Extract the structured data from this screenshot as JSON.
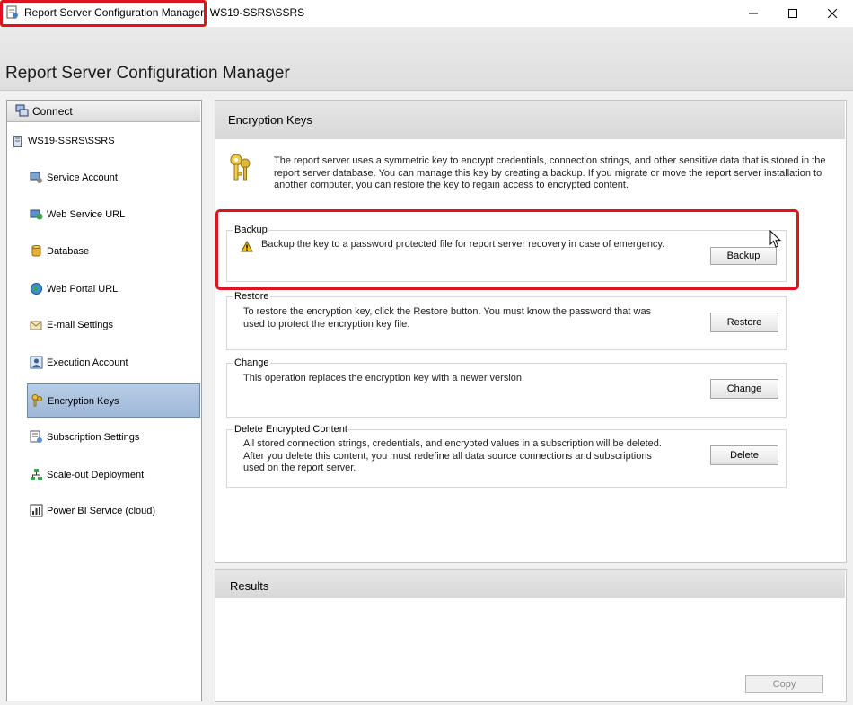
{
  "window": {
    "title_app": "Report Server Configuration Manager",
    "title_sep": ": ",
    "title_server": "WS19-SSRS\\SSRS",
    "minimize_glyph": "—",
    "maximize_glyph": "☐",
    "close_glyph": "✕"
  },
  "header": {
    "app_title": "Report Server Configuration Manager"
  },
  "nav": {
    "connect_label": "Connect",
    "server_label": "WS19-SSRS\\SSRS",
    "items": [
      {
        "label": "Service Account",
        "icon": "service-account-icon"
      },
      {
        "label": "Web Service URL",
        "icon": "web-service-icon"
      },
      {
        "label": "Database",
        "icon": "database-icon"
      },
      {
        "label": "Web Portal URL",
        "icon": "globe-icon"
      },
      {
        "label": "E-mail Settings",
        "icon": "email-icon"
      },
      {
        "label": "Execution Account",
        "icon": "user-icon"
      },
      {
        "label": "Encryption Keys",
        "icon": "keys-icon",
        "selected": true
      },
      {
        "label": "Subscription Settings",
        "icon": "subscription-icon"
      },
      {
        "label": "Scale-out Deployment",
        "icon": "network-icon"
      },
      {
        "label": "Power BI Service (cloud)",
        "icon": "chart-icon"
      }
    ]
  },
  "main": {
    "title": "Encryption Keys",
    "intro": "The report server uses a symmetric key to encrypt credentials, connection strings, and other sensitive data that is stored in the report server database.  You can manage this key by creating a backup.  If you migrate or move the report server installation to another computer, you can restore the key to regain access to encrypted content.",
    "groups": {
      "backup": {
        "label": "Backup",
        "description": "Backup the key to a password protected file for report server recovery in case of emergency.",
        "button": "Backup"
      },
      "restore": {
        "label": "Restore",
        "description": "To restore the encryption key, click the Restore button.  You must know the password that was used to protect the encryption key file.",
        "button": "Restore"
      },
      "change": {
        "label": "Change",
        "description": "This operation replaces the encryption key with a newer version.",
        "button": "Change"
      },
      "delete": {
        "label": "Delete Encrypted Content",
        "description": "All stored connection strings, credentials, and encrypted values in a subscription will be deleted.  After you delete this content, you must redefine all data source connections and subscriptions used on the report server.",
        "button": "Delete"
      }
    }
  },
  "results": {
    "title": "Results",
    "copy_button": "Copy"
  },
  "colors": {
    "highlight": "#e0141e",
    "selected_nav": "#aac0dc",
    "warning": "#f2c200"
  }
}
